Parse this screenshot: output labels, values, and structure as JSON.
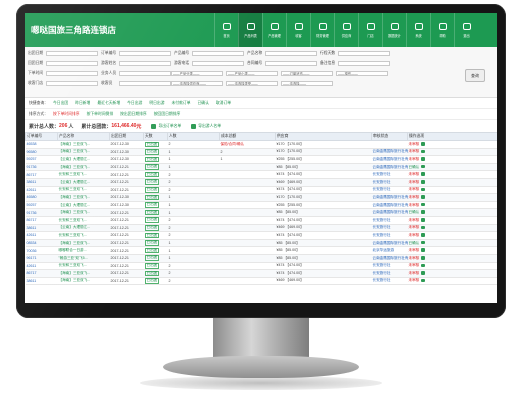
{
  "header": {
    "title": "嗯哒国旅三角路连锁店",
    "nav": [
      {
        "label": "首页",
        "active": false
      },
      {
        "label": "产品列表",
        "active": true
      },
      {
        "label": "产品管理",
        "active": false
      },
      {
        "label": "收客",
        "active": false
      },
      {
        "label": "财务管理",
        "active": false
      },
      {
        "label": "供应商",
        "active": false
      },
      {
        "label": "门店",
        "active": false
      },
      {
        "label": "数据统计",
        "active": false
      },
      {
        "label": "系统",
        "active": false
      },
      {
        "label": "帮助",
        "active": false
      },
      {
        "label": "退出",
        "active": false
      }
    ]
  },
  "filters": {
    "row1": [
      "出团日期",
      "订单编号",
      "产品编号",
      "产品名称",
      "行程天数"
    ],
    "row2": [
      "回团日期",
      "游客姓名",
      "游客电话",
      "合同编号",
      "备注信息"
    ],
    "row3": [
      "下单时间",
      "业务人员",
      "——产品分类——",
      "——产品小类——",
      "——订单状态——",
      "——操作——"
    ],
    "row4": [
      "收客门店",
      "收客员",
      "——请选择供应商——",
      "——请选择类型——",
      "——请选择——"
    ],
    "query_button": "查询"
  },
  "status1": {
    "label": "快捷查询：",
    "items": [
      "今日出团",
      "昨日新增",
      "最近七天新增",
      "今日出游",
      "明日出游",
      "未付款订单",
      "已确认",
      "取消订单"
    ]
  },
  "status2": {
    "label": "排序方式：",
    "items": [
      "按下单时间排序",
      "按下单时间倒排",
      "按出团日期排序",
      "按回团日期排序"
    ]
  },
  "summary": {
    "people_label": "累计总人数：",
    "people_value": "206",
    "people_unit": "人",
    "amount_label": "累计总团款：",
    "amount_value": "161,466.40",
    "amount_unit": "元",
    "export1": "导出订单名单",
    "export2": "导出游人名单"
  },
  "table": {
    "headers": [
      "订单编号",
      "产品名称",
      "出团日期",
      "天数",
      "人数",
      "成本总额",
      "供应商",
      "审核状态",
      "操作选项"
    ],
    "rows": [
      {
        "id": "46538",
        "name": "【海南】三亚双飞...",
        "date": "2017-12-30",
        "days": "已出团",
        "num": "2",
        "people": "保险/合同/确认",
        "cost": "¥170 【170.00】",
        "supplier": "",
        "status": "未审核",
        "op1": "明细",
        "op2": "变更"
      },
      {
        "id": "96580",
        "name": "【海南】三亚双飞...",
        "date": "2017-12-30",
        "days": "已出团",
        "num": "1",
        "people": "2",
        "cost": "¥170 【170.00】",
        "supplier": "云南金鹰国际旅行社有限公司",
        "status": "未审核",
        "op1": "明细",
        "op2": "变更"
      },
      {
        "id": "59257",
        "name": "【云南】大理丽江...",
        "date": "2017-12-30",
        "days": "已出团",
        "num": "1",
        "people": "1",
        "cost": "¥255 【255.00】",
        "supplier": "云南金鹰国际旅行社有限公司",
        "status": "未审核",
        "op1": "明细",
        "op2": "变更"
      },
      {
        "id": "91736",
        "name": "【海南】三亚双飞...",
        "date": "2017-12-21",
        "days": "已出团",
        "num": "1",
        "people": "",
        "cost": "¥85 【85.00】",
        "supplier": "云南金鹰国际旅行社有限公司",
        "status": "已确认",
        "op1": "明细",
        "op2": "变更"
      },
      {
        "id": "86717",
        "name": "长安和三亚双飞...",
        "date": "2017-12-21",
        "days": "已出团",
        "num": "2",
        "people": "",
        "cost": "¥474 【474.00】",
        "supplier": "长安旅行社",
        "status": "未审核",
        "op1": "明细",
        "op2": "变更"
      },
      {
        "id": "38611",
        "name": "【云南】大理丽江...",
        "date": "2017-12-21",
        "days": "已出团",
        "num": "2",
        "people": "",
        "cost": "¥469 【469.00】",
        "supplier": "长安旅行社",
        "status": "未审核",
        "op1": "明细",
        "op2": "变更"
      },
      {
        "id": "42611",
        "name": "长安和三亚双飞...",
        "date": "2017-12-21",
        "days": "已出团",
        "num": "2",
        "people": "",
        "cost": "¥474 【474.00】",
        "supplier": "长安旅行社",
        "status": "未审核",
        "op1": "明细",
        "op2": "变更"
      },
      {
        "id": "46580",
        "name": "【海南】三亚双飞...",
        "date": "2017-12-30",
        "days": "已出团",
        "num": "1",
        "people": "",
        "cost": "¥170 【170.00】",
        "supplier": "云南金鹰国际旅行社有限公司",
        "status": "未审核",
        "op1": "明细",
        "op2": "变更"
      },
      {
        "id": "59257",
        "name": "【云南】大理丽江...",
        "date": "2017-12-30",
        "days": "已出团",
        "num": "1",
        "people": "",
        "cost": "¥255 【255.00】",
        "supplier": "云南金鹰国际旅行社有限公司",
        "status": "未审核",
        "op1": "明细",
        "op2": "变更"
      },
      {
        "id": "91736",
        "name": "【海南】三亚双飞...",
        "date": "2017-12-21",
        "days": "已出团",
        "num": "1",
        "people": "",
        "cost": "¥85 【85.00】",
        "supplier": "云南金鹰国际旅行社有限公司",
        "status": "已确认",
        "op1": "明细",
        "op2": "变更"
      },
      {
        "id": "86717",
        "name": "长安和三亚双飞...",
        "date": "2017-12-21",
        "days": "已出团",
        "num": "2",
        "people": "",
        "cost": "¥474 【474.00】",
        "supplier": "长安旅行社",
        "status": "未审核",
        "op1": "明细",
        "op2": "变更"
      },
      {
        "id": "38611",
        "name": "【云南】大理丽江...",
        "date": "2017-12-21",
        "days": "已出团",
        "num": "2",
        "people": "",
        "cost": "¥469 【469.00】",
        "supplier": "长安旅行社",
        "status": "未审核",
        "op1": "明细",
        "op2": "变更"
      },
      {
        "id": "42611",
        "name": "长安和三亚双飞...",
        "date": "2017-12-21",
        "days": "已出团",
        "num": "2",
        "people": "",
        "cost": "¥474 【474.00】",
        "supplier": "长安旅行社",
        "status": "未审核",
        "op1": "明细",
        "op2": "变更"
      },
      {
        "id": "08534",
        "name": "【海南】三亚双飞...",
        "date": "2017-12-21",
        "days": "已出团",
        "num": "1",
        "people": "",
        "cost": "¥85 【85.00】",
        "supplier": "云南金鹰国际旅行社有限公司",
        "status": "已确认",
        "op1": "明细",
        "op2": "变更"
      },
      {
        "id": "70036",
        "name": "嘟嘟联合一日游...",
        "date": "2017-12-21",
        "days": "已出团",
        "num": "1",
        "people": "",
        "cost": "¥85 【85.00】",
        "supplier": "北京华运旅游",
        "status": "未审核",
        "op1": "明细",
        "op2": "变更"
      },
      {
        "id": "96171",
        "name": "\"畅游三亚\"双飞5...",
        "date": "2017-12-21",
        "days": "已出团",
        "num": "1",
        "people": "",
        "cost": "¥85 【85.00】",
        "supplier": "云南金鹰国际旅行社有限公司",
        "status": "未审核",
        "op1": "明细",
        "op2": "变更"
      },
      {
        "id": "42611",
        "name": "长安和三亚双飞...",
        "date": "2017-12-21",
        "days": "已出团",
        "num": "2",
        "people": "",
        "cost": "¥474 【474.00】",
        "supplier": "长安旅行社",
        "status": "未审核",
        "op1": "明细",
        "op2": "变更"
      },
      {
        "id": "86717",
        "name": "【海南】三亚双飞...",
        "date": "2017-12-21",
        "days": "已出团",
        "num": "2",
        "people": "",
        "cost": "¥474 【474.00】",
        "supplier": "长安旅行社",
        "status": "未审核",
        "op1": "明细",
        "op2": "变更"
      },
      {
        "id": "38611",
        "name": "【海南】三亚双飞...",
        "date": "2017-12-21",
        "days": "已出团",
        "num": "2",
        "people": "",
        "cost": "¥469 【469.00】",
        "supplier": "长安旅行社",
        "status": "未审核",
        "op1": "明细",
        "op2": "变更"
      }
    ]
  },
  "colors": {
    "brand": "#1d9a52",
    "alert": "#dd2222",
    "link": "#2563b8"
  }
}
